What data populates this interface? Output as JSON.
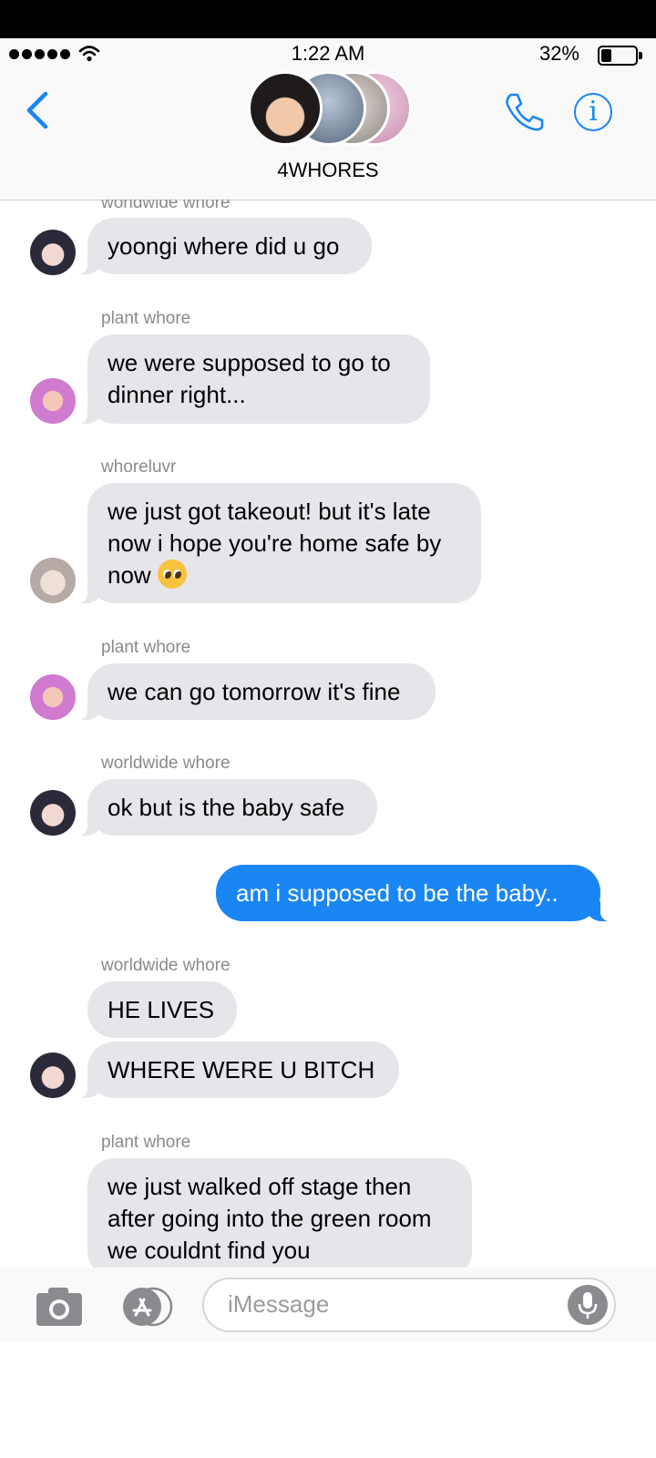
{
  "status_bar": {
    "time": "1:22 AM",
    "battery": "32%"
  },
  "header": {
    "group_name": "4WHORES"
  },
  "colors": {
    "accent": "#1a86f4",
    "incoming_bubble": "#e6e5ea",
    "sender_gray": "#8a8a8e"
  },
  "messages": [
    {
      "sender": "worldwide whore",
      "text": "yoongi where did u go"
    },
    {
      "sender": "plant whore",
      "lines": [
        "we were supposed to go to",
        "dinner right..."
      ]
    },
    {
      "sender": "whoreluvr",
      "lines": [
        "we just got takeout! but it's late",
        "now i hope you're home safe by",
        "now"
      ],
      "emoji": "pleading-face-emoji"
    },
    {
      "sender": "plant whore",
      "text": "we can go tomorrow it's fine"
    },
    {
      "sender": "worldwide whore",
      "text": "ok but is the baby safe"
    },
    {
      "outgoing": true,
      "text": "am i supposed to be the baby.."
    },
    {
      "sender": "worldwide whore",
      "texts": [
        "HE LIVES",
        "WHERE WERE U BITCH"
      ]
    },
    {
      "sender": "plant whore",
      "lines": [
        "we just walked off stage then",
        "after going into the green room",
        "we couldnt find you"
      ]
    }
  ],
  "composer": {
    "placeholder": "iMessage"
  },
  "icons": [
    "back-chevron-icon",
    "phone-icon",
    "info-icon",
    "camera-icon",
    "app-store-icon",
    "microphone-icon"
  ]
}
